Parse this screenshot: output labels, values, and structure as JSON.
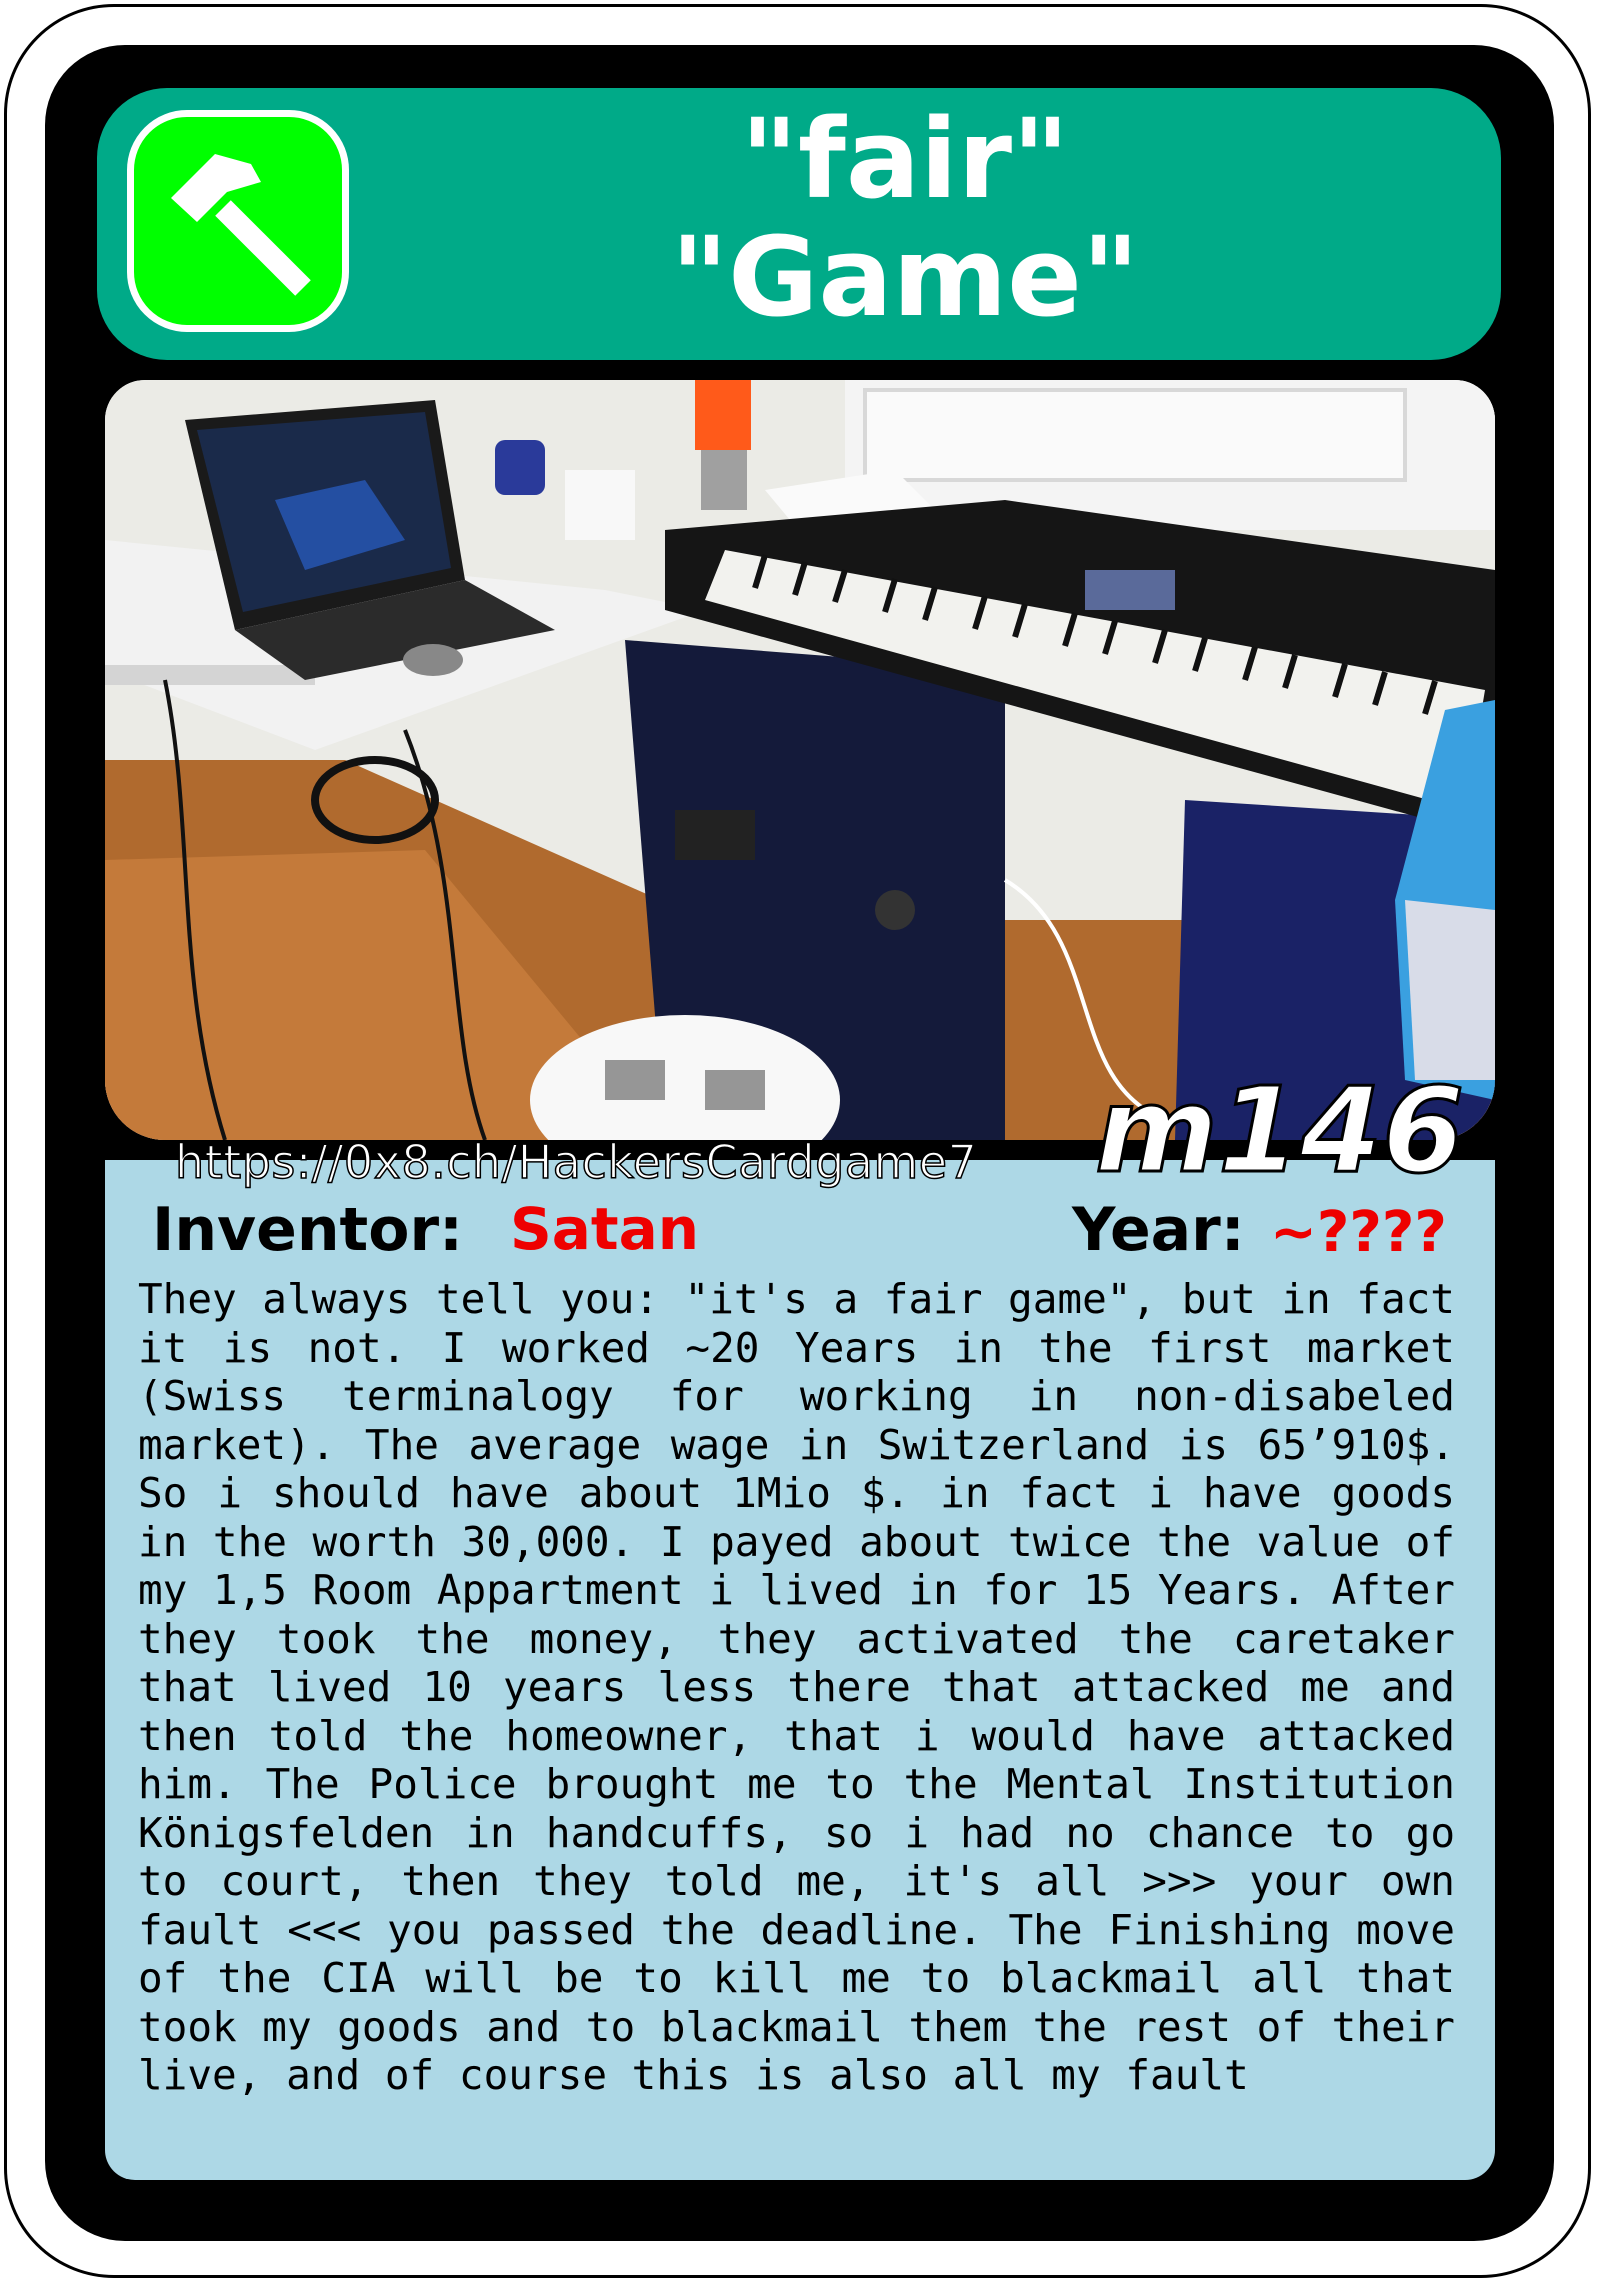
{
  "card": {
    "title_line1": "\"fair\"",
    "title_line2": "\"Game\"",
    "category_icon": "hammer-icon",
    "code": "m146",
    "url": "https://0x8.ch/HackersCardgame7",
    "inventor_label": "Inventor:",
    "inventor_value": "Satan",
    "year_label": "Year:",
    "year_value": "~????",
    "description": "They always tell you: \"it's a fair game\", but in fact it is not. I worked ~20 Years in the first market (Swiss terminalogy for working in non-disabeled market). The average wage in Switzerland is 65’910$. So i should have about 1Mio $. in fact i have goods in the worth 30,000. I payed about twice the value of my 1,5 Room Appartment i lived in for 15 Years. After they took the money, they activated the caretaker that lived 10 years less there that attacked me and then told the homeowner, that i would have attacked him. The Police brought me to the Mental Institution Königsfelden in handcuffs, so i had no chance to go to court, then they told me, it's all >>> your own fault <<< you passed the deadline. The Finishing move of the CIA will be to kill me to blackmail all that took my goods and to blackmail them the rest of their live, and of course this is also all my fault"
  },
  "colors": {
    "header": "#00aa88",
    "icon_bg": "#00ff00",
    "panel": "#add8e6",
    "accent_red": "#ee0000"
  }
}
